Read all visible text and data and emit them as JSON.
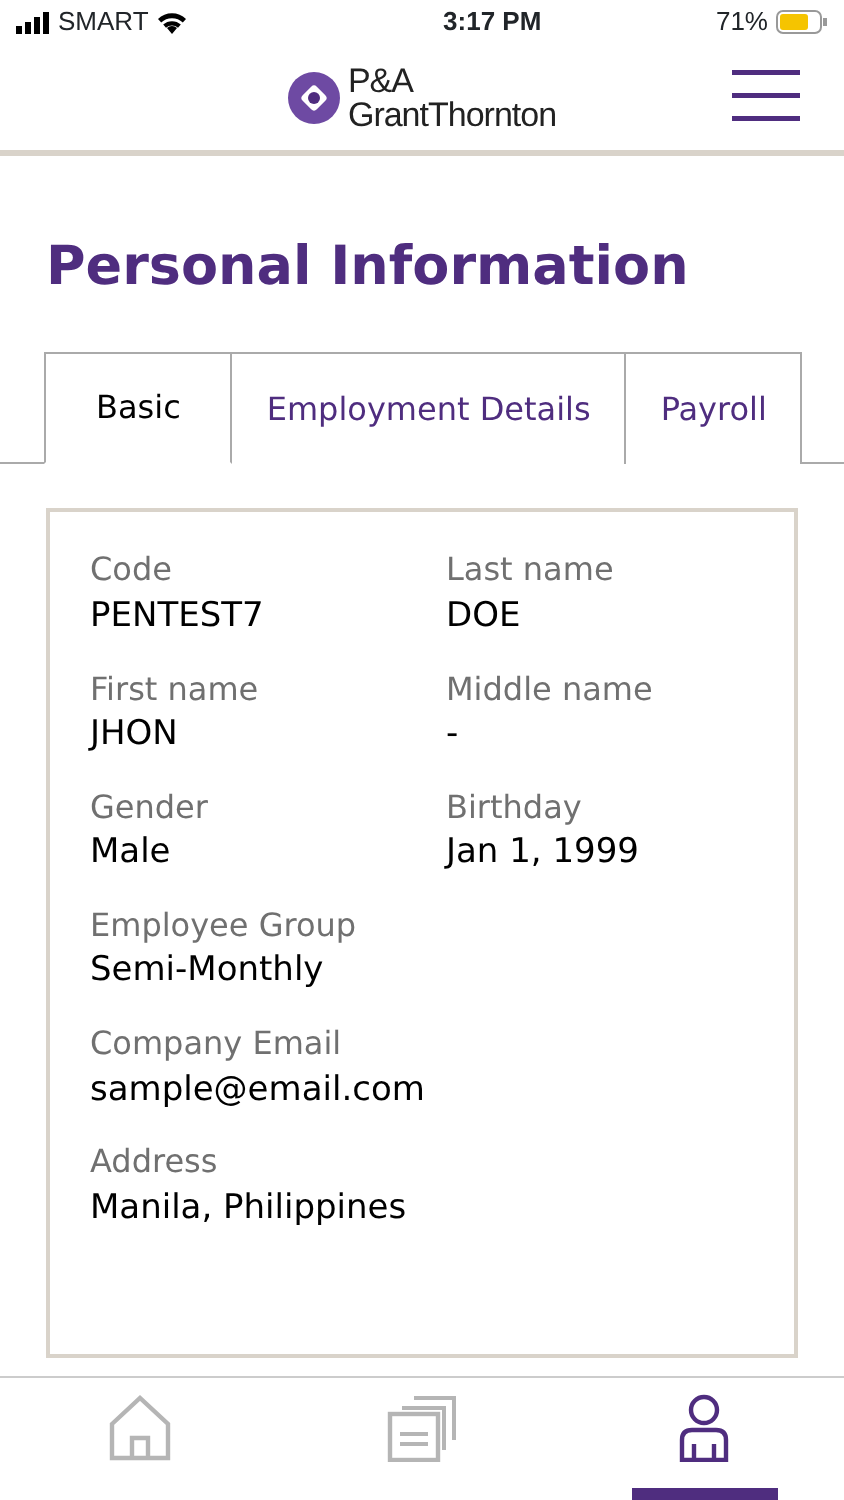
{
  "status_bar": {
    "carrier": "SMART",
    "time": "3:17 PM",
    "battery": "71%"
  },
  "header": {
    "logo_line_1": "P&A",
    "logo_line_2": "GrantThornton"
  },
  "page_title": "Personal Information",
  "tabs": [
    {
      "label": "Basic",
      "selected": true
    },
    {
      "label": "Employment Details",
      "selected": false
    },
    {
      "label": "Payroll",
      "selected": false
    }
  ],
  "fields": [
    [
      {
        "label": "Code",
        "value": "PENTEST7"
      },
      {
        "label": "Last name",
        "value": "DOE"
      }
    ],
    [
      {
        "label": "First name",
        "value": "JHON"
      },
      {
        "label": "Middle name",
        "value": "-"
      }
    ],
    [
      {
        "label": "Gender",
        "value": "Male"
      },
      {
        "label": "Birthday",
        "value": "Jan 1, 1999"
      }
    ],
    [
      {
        "label": "Employee Group",
        "value": "Semi-Monthly"
      }
    ],
    [
      {
        "label": "Company Email",
        "value": "sample@email.com"
      }
    ],
    [
      {
        "label": "Address",
        "value": "Manila, Philippines"
      }
    ]
  ],
  "bottom_nav": [
    {
      "kind": "home",
      "selected": false
    },
    {
      "kind": "documents",
      "selected": false
    },
    {
      "kind": "profile",
      "selected": true
    }
  ]
}
